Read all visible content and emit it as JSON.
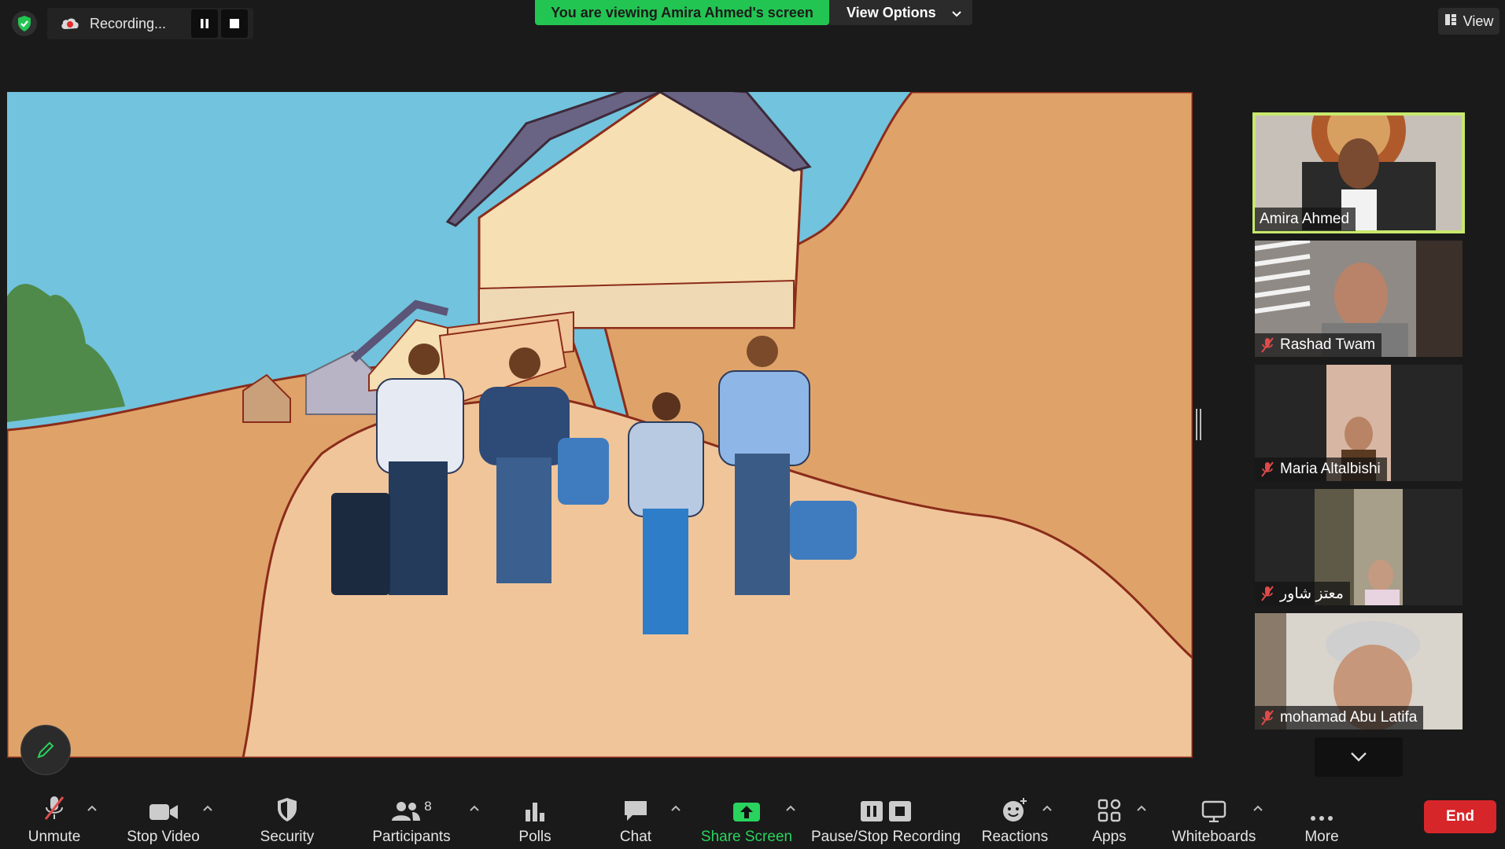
{
  "top_bar": {
    "recording_label": "Recording...",
    "viewing_banner": "You are viewing Amira Ahmed's screen",
    "view_options_label": "View Options",
    "view_label": "View"
  },
  "participants": [
    {
      "name": "Amira Ahmed",
      "muted": false,
      "active_speaker": true
    },
    {
      "name": "Rashad Twam",
      "muted": true
    },
    {
      "name": "Maria Altalbishi",
      "muted": true
    },
    {
      "name": "معتز شاور",
      "muted": true
    },
    {
      "name": "mohamad Abu Latifa",
      "muted": true
    }
  ],
  "toolbar": {
    "unmute": "Unmute",
    "stop_video": "Stop Video",
    "security": "Security",
    "participants": "Participants",
    "participants_count": "8",
    "polls": "Polls",
    "chat": "Chat",
    "share_screen": "Share Screen",
    "pause_stop_recording": "Pause/Stop Recording",
    "reactions": "Reactions",
    "apps": "Apps",
    "whiteboards": "Whiteboards",
    "more": "More",
    "end": "End"
  },
  "colors": {
    "viewing_banner": "#23c552",
    "active_speaker_border": "#c7e86d",
    "end_button": "#d7262a",
    "share_screen_accent": "#29d35e"
  }
}
